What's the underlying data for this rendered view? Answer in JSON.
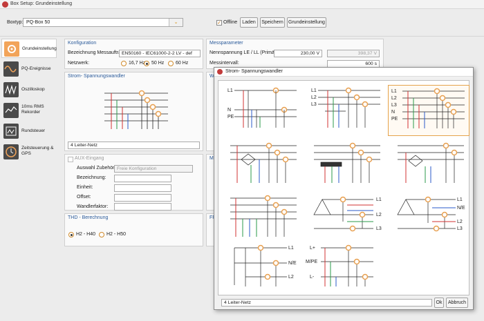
{
  "window": {
    "title": "Box Setup: Grundeinstellung"
  },
  "toolbar": {
    "boxtyp_label": "Boxtyp:",
    "boxtyp_value": "PQ-Box 50",
    "offline_label": "Offline",
    "offline_checked": true,
    "laden": "Laden",
    "speichern": "Speichern",
    "grundeinstellung": "Grundeinstellung"
  },
  "sidebar": {
    "items": [
      {
        "label": "Grundeinstellung",
        "icon": "settings-icon",
        "active": true
      },
      {
        "label": "PQ-Ereignisse",
        "icon": "waveform-icon"
      },
      {
        "label": "Oszilloskop",
        "icon": "oscilloscope-icon"
      },
      {
        "label": "10ms RMS Rekorder",
        "icon": "rms-recorder-icon"
      },
      {
        "label": "Rundsteuer",
        "icon": "ripple-control-icon"
      },
      {
        "label": "Zeitsteuerung & GPS",
        "icon": "clock-gps-icon"
      }
    ]
  },
  "konfiguration": {
    "title": "Konfiguration",
    "bez_label": "Bezeichnung Messauftrag:",
    "bez_value": "EN50160 - IEC61000-2-2 LV - def",
    "netzwerk_label": "Netzwerk:",
    "options": [
      "16,7 Hz",
      "50 Hz",
      "60 Hz"
    ],
    "selected": "50 Hz"
  },
  "messparameter": {
    "title": "Messparameter",
    "nenn_label": "Nennspannung LE / LL (Primär):",
    "nenn_value": "230,00 V",
    "nenn_value2": "398,37 V",
    "intervall_label": "Messintervall:",
    "intervall_value": "600 s"
  },
  "wandler": {
    "title": "Strom- Spannungswandler",
    "value": "4 Leiter-Netz",
    "side_title_fragment": "Wa"
  },
  "aux": {
    "title": "AUX-Eingang",
    "zubehoer_label": "Auswahl Zubehör:",
    "zubehoer_value": "Freie Konfiguration",
    "labels": [
      "Bezeichnung:",
      "Einheit:",
      "Offset:",
      "Wandlerfaktor:"
    ]
  },
  "thd": {
    "title": "THD - Berechnung",
    "options": [
      "H2 - H40",
      "H2 - H50"
    ],
    "selected": "H2 - H40"
  },
  "partial": {
    "me": "Me",
    "fft": "FFT",
    "s": "S"
  },
  "dialog": {
    "title": "Strom- Spannungswandler",
    "value": "4 Leiter-Netz",
    "ok": "Ok",
    "abbruch": "Abbruch",
    "labels": {
      "l1": "L1",
      "l2": "L2",
      "l3": "L3",
      "n": "N",
      "pe": "PE",
      "e": "E",
      "ne": "N/E",
      "lplus": "L+",
      "lminus": "L-",
      "mpe": "M/PE"
    }
  },
  "colors": {
    "accent": "#e8a050",
    "title_blue": "#2a5a9a",
    "wire_red": "#d23030",
    "wire_green": "#2a9a4a",
    "wire_blue": "#2a5ac8"
  }
}
